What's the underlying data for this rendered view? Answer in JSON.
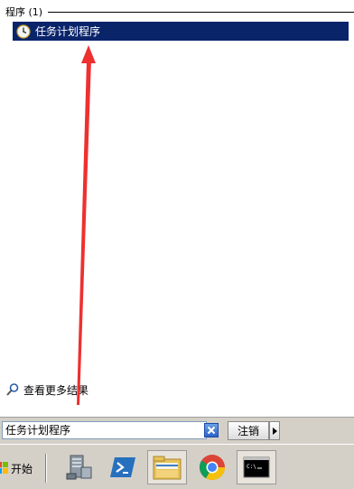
{
  "results": {
    "section_title": "程序 (1)",
    "items": [
      {
        "label": "任务计划程序",
        "icon": "clock-icon"
      }
    ],
    "see_more_label": "查看更多结果"
  },
  "search": {
    "value": "任务计划程序",
    "clear_icon": "clear-x-icon",
    "logoff_label": "注销",
    "logoff_arrow_icon": "triangle-right-icon"
  },
  "taskbar": {
    "start_label": "开始",
    "apps": [
      {
        "name": "server-manager",
        "icon": "server-manager-icon"
      },
      {
        "name": "powershell",
        "icon": "powershell-icon"
      },
      {
        "name": "file-explorer",
        "icon": "folder-icon"
      },
      {
        "name": "chrome",
        "icon": "chrome-icon"
      },
      {
        "name": "command-prompt",
        "icon": "cmd-icon"
      }
    ]
  },
  "colors": {
    "selection": "#0a246a",
    "annotation_arrow": "#ee3030"
  }
}
